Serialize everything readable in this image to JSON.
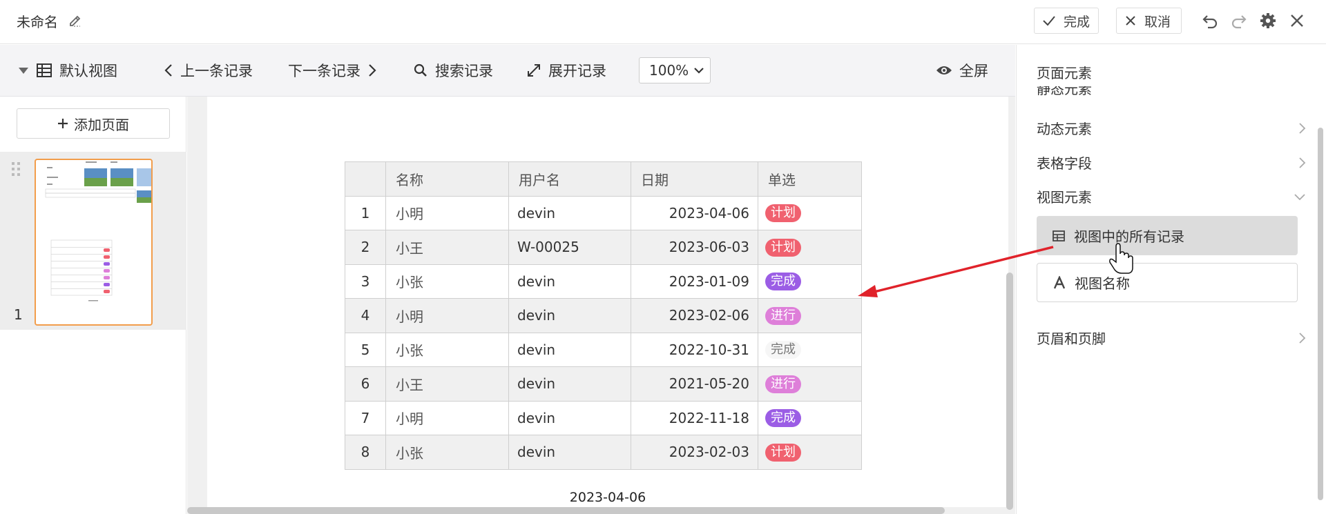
{
  "window": {
    "title": "未命名",
    "done_label": "完成",
    "cancel_label": "取消"
  },
  "toolbar": {
    "view_name": "默认视图",
    "prev_record": "上一条记录",
    "next_record": "下一条记录",
    "search_record": "搜索记录",
    "expand_record": "展开记录",
    "zoom": "100%",
    "fullscreen": "全屏"
  },
  "left_panel": {
    "add_page": "添加页面",
    "page_number": "1"
  },
  "table": {
    "headers": [
      "名称",
      "用户名",
      "日期",
      "单选"
    ],
    "rows": [
      {
        "idx": "1",
        "name": "小明",
        "user": "devin",
        "date": "2023-04-06",
        "tag": "计划",
        "tag_color": "#f0616f"
      },
      {
        "idx": "2",
        "name": "小王",
        "user": "W-00025",
        "date": "2023-06-03",
        "tag": "计划",
        "tag_color": "#f0616f"
      },
      {
        "idx": "3",
        "name": "小张",
        "user": "devin",
        "date": "2023-01-09",
        "tag": "完成",
        "tag_color": "#9b5de5"
      },
      {
        "idx": "4",
        "name": "小明",
        "user": "devin",
        "date": "2023-02-06",
        "tag": "进行",
        "tag_color": "#de7fd9"
      },
      {
        "idx": "5",
        "name": "小张",
        "user": "devin",
        "date": "2022-10-31",
        "tag": "完成",
        "tag_color": ""
      },
      {
        "idx": "6",
        "name": "小王",
        "user": "devin",
        "date": "2021-05-20",
        "tag": "进行",
        "tag_color": "#de7fd9"
      },
      {
        "idx": "7",
        "name": "小明",
        "user": "devin",
        "date": "2022-11-18",
        "tag": "完成",
        "tag_color": "#9b5de5"
      },
      {
        "idx": "8",
        "name": "小张",
        "user": "devin",
        "date": "2023-02-03",
        "tag": "计划",
        "tag_color": "#f0616f"
      }
    ],
    "footer_date": "2023-04-06"
  },
  "right_panel": {
    "title": "页面元素",
    "cut_section": "静态元素",
    "sections": {
      "dynamic": "动态元素",
      "table_fields": "表格字段",
      "view_elements": "视图元素",
      "header_footer": "页眉和页脚"
    },
    "cards": {
      "all_records": "视图中的所有记录",
      "view_name": "视图名称"
    }
  }
}
